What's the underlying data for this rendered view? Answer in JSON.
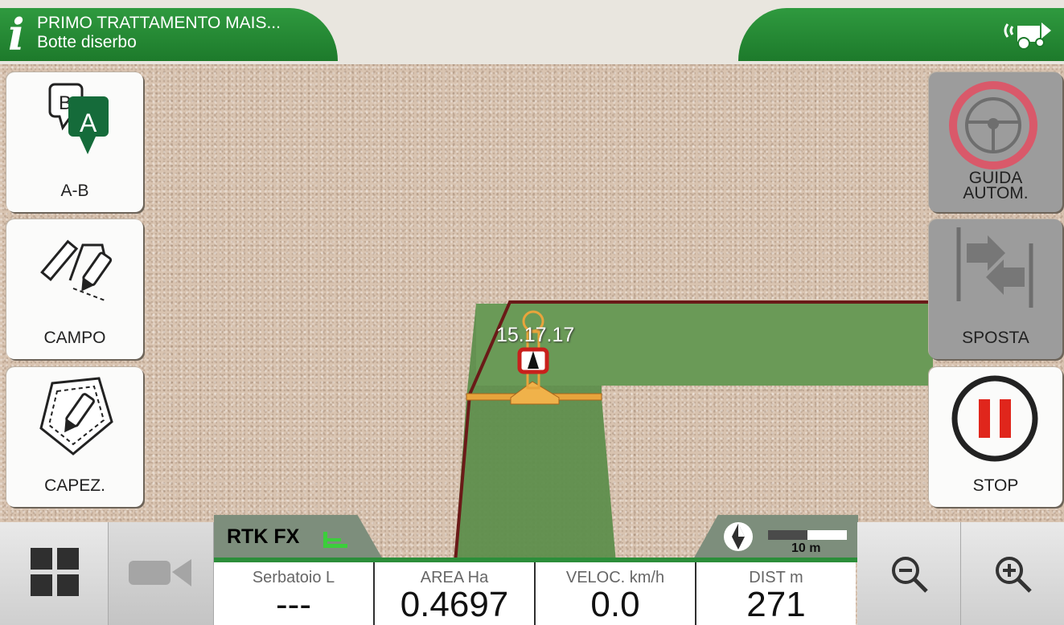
{
  "header": {
    "job_title": "PRIMO TRATTAMENTO MAIS...",
    "job_subtitle": "Botte diserbo",
    "info_icon": "info-icon",
    "status_icon": "gps-signal-tractor-icon"
  },
  "left_buttons": [
    {
      "label": "A-B",
      "icon": "ab-line-markers-icon"
    },
    {
      "label": "CAMPO",
      "icon": "field-draw-icon"
    },
    {
      "label": "CAPEZ.",
      "icon": "headland-draw-icon"
    }
  ],
  "right_buttons": {
    "autosteer_label_1": "GUIDA",
    "autosteer_label_2": "AUTOM.",
    "shift_label": "SPOSTA",
    "stop_label": "STOP"
  },
  "map": {
    "time_label": "15.17.17",
    "scale_label": "10 m"
  },
  "gps": {
    "status": "RTK FX"
  },
  "stats": [
    {
      "title": "Serbatoio L",
      "value": "---"
    },
    {
      "title": "AREA Ha",
      "value": "0.4697"
    },
    {
      "title": "VELOC. km/h",
      "value": "0.0"
    },
    {
      "title": "DIST m",
      "value": "271"
    }
  ],
  "colors": {
    "header_green": "#2f9a3f",
    "field_green": "#5e8e4c",
    "boundary": "#6a1a18",
    "stop_red": "#e0261c",
    "autosteer_ring": "#d9596a"
  }
}
